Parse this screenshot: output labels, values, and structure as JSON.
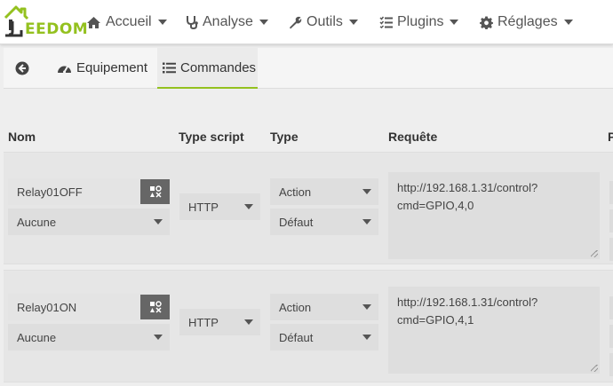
{
  "app": {
    "logo_text": "EEDOM",
    "accent_color": "#94c11f"
  },
  "navbar": {
    "items": [
      {
        "label": "Accueil",
        "icon": "home-icon"
      },
      {
        "label": "Analyse",
        "icon": "stethoscope-icon"
      },
      {
        "label": "Outils",
        "icon": "wrench-icon"
      },
      {
        "label": "Plugins",
        "icon": "tasks-icon"
      },
      {
        "label": "Réglages",
        "icon": "cog-icon"
      }
    ]
  },
  "tabs": {
    "back_icon": "arrow-circle-left-icon",
    "items": [
      {
        "label": "Equipement",
        "icon": "tachometer-icon",
        "active": false
      },
      {
        "label": "Commandes",
        "icon": "list-icon",
        "active": true
      }
    ]
  },
  "table": {
    "headers": [
      "Nom",
      "Type script",
      "Type",
      "Requête"
    ],
    "rows": [
      {
        "name": "Relay01OFF",
        "icon_value": "Aucune",
        "script_type": "HTTP",
        "type": "Action",
        "subtype": "Défaut",
        "request": "http://192.168.1.31/control?cmd=GPIO,4,0"
      },
      {
        "name": "Relay01ON",
        "icon_value": "Aucune",
        "script_type": "HTTP",
        "type": "Action",
        "subtype": "Défaut",
        "request": "http://192.168.1.31/control?cmd=GPIO,4,1"
      }
    ]
  }
}
